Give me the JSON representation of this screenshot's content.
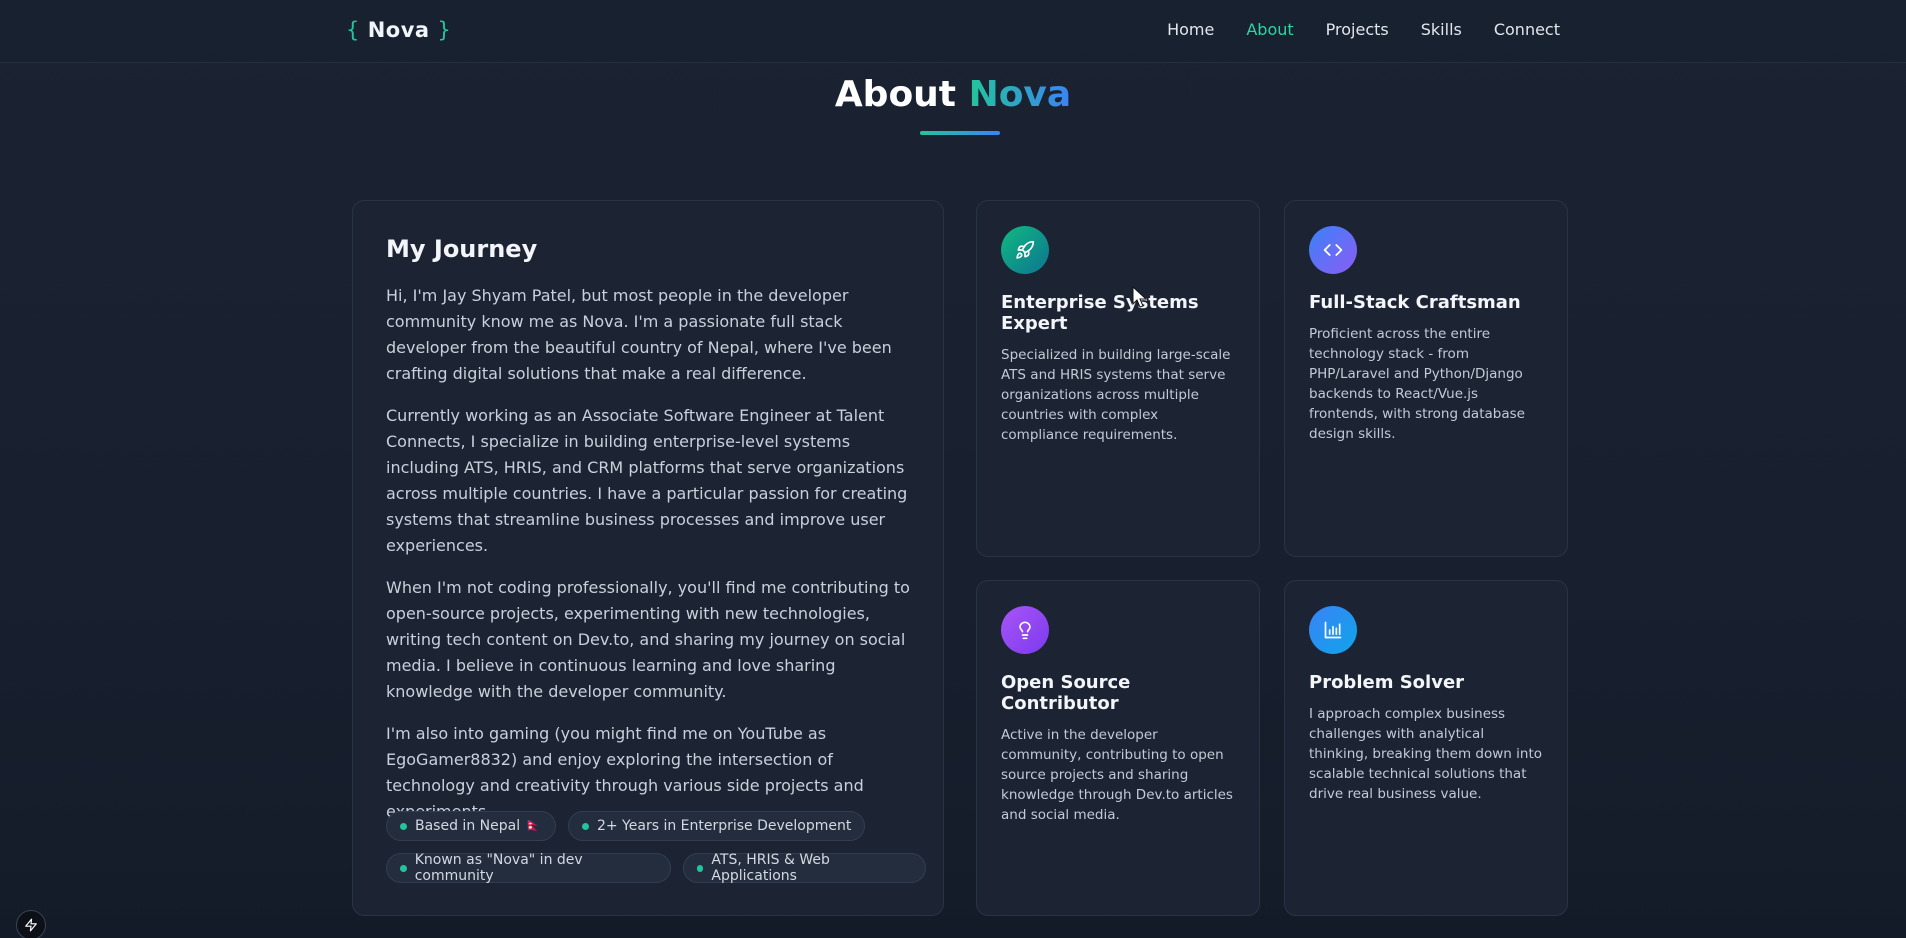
{
  "header": {
    "logo_open": "{",
    "logo_text": "Nova",
    "logo_close": "}",
    "nav": [
      {
        "label": "Home"
      },
      {
        "label": "About"
      },
      {
        "label": "Projects"
      },
      {
        "label": "Skills"
      },
      {
        "label": "Connect"
      }
    ],
    "active_nav": "About"
  },
  "section": {
    "title_prefix": "About",
    "title_accent": "Nova"
  },
  "journey": {
    "title": "My Journey",
    "paragraphs": [
      "Hi, I'm Jay Shyam Patel, but most people in the developer community know me as Nova. I'm a passionate full stack developer from the beautiful country of Nepal, where I've been crafting digital solutions that make a real difference.",
      "Currently working as an Associate Software Engineer at Talent Connects, I specialize in building enterprise-level systems including ATS, HRIS, and CRM platforms that serve organizations across multiple countries. I have a particular passion for creating systems that streamline business processes and improve user experiences.",
      "When I'm not coding professionally, you'll find me contributing to open-source projects, experimenting with new technologies, writing tech content on Dev.to, and sharing my journey on social media. I believe in continuous learning and love sharing knowledge with the developer community.",
      "I'm also into gaming (you might find me on YouTube as EgoGamer8832) and enjoy exploring the intersection of technology and creativity through various side projects and experiments."
    ],
    "tags": [
      "Based in Nepal 🇳🇵",
      "2+ Years in Enterprise Development",
      "Known as \"Nova\" in dev community",
      "ATS, HRIS & Web Applications"
    ]
  },
  "features": [
    {
      "icon": "rocket-icon",
      "title": "Enterprise Systems Expert",
      "description": "Specialized in building large-scale ATS and HRIS systems that serve organizations across multiple countries with complex compliance requirements."
    },
    {
      "icon": "code-icon",
      "title": "Full-Stack Craftsman",
      "description": "Proficient across the entire technology stack - from PHP/Laravel and Python/Django backends to React/Vue.js frontends, with strong database design skills."
    },
    {
      "icon": "lightbulb-icon",
      "title": "Open Source Contributor",
      "description": "Active in the developer community, contributing to open source projects and sharing knowledge through Dev.to articles and social media."
    },
    {
      "icon": "bar-chart-icon",
      "title": "Problem Solver",
      "description": "I approach complex business challenges with analytical thinking, breaking them down into scalable technical solutions that drive real business value."
    }
  ],
  "colors": {
    "accent_green": "#22c59a",
    "accent_blue": "#3b82f6",
    "background": "#1b2333",
    "card": "#1c2434"
  }
}
